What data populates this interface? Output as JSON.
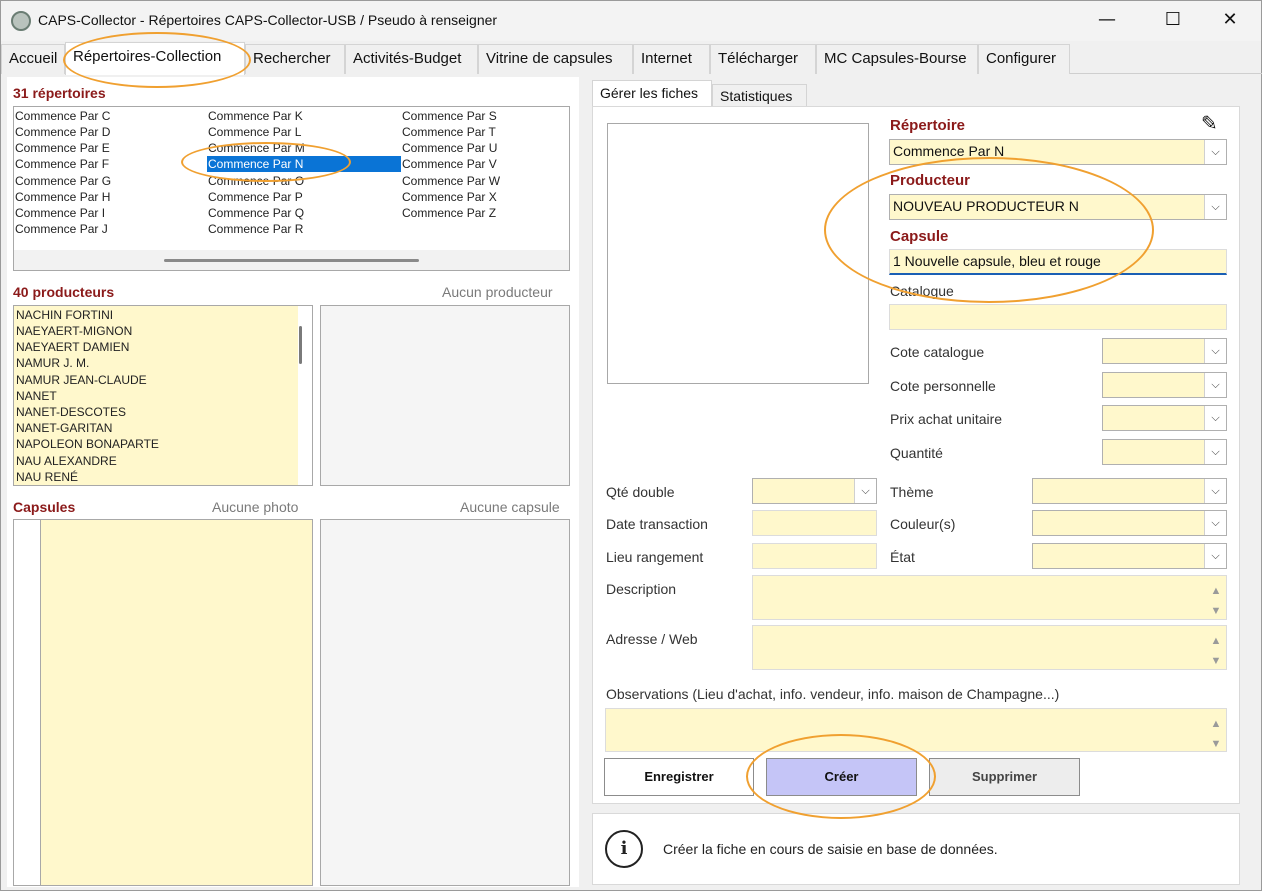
{
  "window": {
    "title": "CAPS-Collector - Répertoires CAPS-Collector-USB / Pseudo à renseigner",
    "minimize": "—",
    "maximize": "☐",
    "close": "✕"
  },
  "tabs": [
    "Accueil",
    "Répertoires-Collection",
    "Rechercher",
    "Activités-Budget",
    "Vitrine de capsules",
    "Internet",
    "Télécharger",
    "MC Capsules-Bourse",
    "Configurer"
  ],
  "repertoires": {
    "title": "31 répertoires",
    "col1": [
      "Commence Par C",
      "Commence Par D",
      "Commence Par E",
      "Commence Par F",
      "Commence Par G",
      "Commence Par H",
      "Commence Par I",
      "Commence Par J"
    ],
    "col2": [
      "Commence Par K",
      "Commence Par L",
      "Commence Par M",
      "Commence Par N",
      "Commence Par O",
      "Commence Par P",
      "Commence Par Q",
      "Commence Par R"
    ],
    "col3": [
      "Commence Par S",
      "Commence Par T",
      "Commence Par U",
      "Commence Par V",
      "Commence Par W",
      "Commence Par X",
      "Commence Par Z"
    ],
    "selected": "Commence Par N"
  },
  "producteurs": {
    "title": "40 producteurs",
    "empty_hint": "Aucun producteur",
    "items": [
      "NACHIN FORTINI",
      "NAEYAERT-MIGNON",
      "NAEYAERT DAMIEN",
      "NAMUR J. M.",
      "NAMUR JEAN-CLAUDE",
      "NANET",
      "NANET-DESCOTES",
      "NANET-GARITAN",
      "NAPOLEON BONAPARTE",
      "NAU ALEXANDRE",
      "NAU RENÉ"
    ]
  },
  "capsules": {
    "title": "Capsules",
    "photo_hint": "Aucune photo",
    "capsule_hint": "Aucune capsule"
  },
  "subtabs": [
    "Gérer les fiches",
    "Statistiques"
  ],
  "form": {
    "repertoire_label": "Répertoire",
    "repertoire_value": "Commence Par N",
    "producteur_label": "Producteur",
    "producteur_value": "NOUVEAU PRODUCTEUR N",
    "capsule_label": "Capsule",
    "capsule_value": "1 Nouvelle capsule, bleu et rouge",
    "catalogue_label": "Catalogue",
    "cote_catalogue": "Cote catalogue",
    "cote_personnelle": "Cote personnelle",
    "prix_achat": "Prix achat unitaire",
    "quantite": "Quantité",
    "qte_double": "Qté double",
    "theme": "Thème",
    "date_transaction": "Date transaction",
    "couleurs": "Couleur(s)",
    "lieu_rangement": "Lieu rangement",
    "etat": "État",
    "description": "Description",
    "adresse_web": "Adresse / Web",
    "observations": "Observations (Lieu d'achat, info. vendeur, info. maison de Champagne...)"
  },
  "buttons": {
    "enregistrer": "Enregistrer",
    "creer": "Créer",
    "supprimer": "Supprimer"
  },
  "status": {
    "message": "Créer la fiche en cours de saisie en base de données.",
    "icon": "i"
  },
  "colors": {
    "section_title": "#8b1a1a",
    "field_bg": "#fff8cc",
    "selection": "#0a74d6",
    "creer_button": "#c5c5f7",
    "annotation_ring": "#f0a030"
  }
}
